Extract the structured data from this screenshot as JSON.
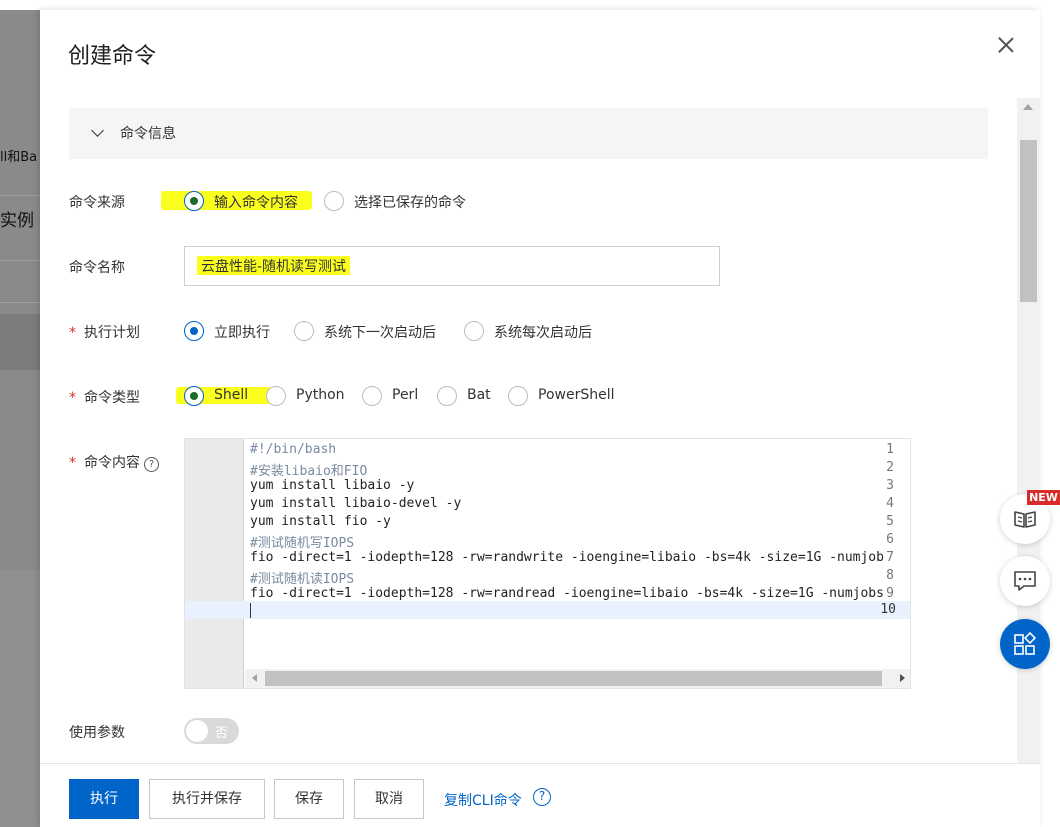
{
  "background": {
    "fragments": [
      "ll和Ba",
      "实例"
    ]
  },
  "drawer": {
    "title": "创建命令",
    "section_title": "命令信息",
    "fields": {
      "source": {
        "label": "命令来源",
        "options": [
          "输入命令内容",
          "选择已保存的命令"
        ],
        "selected": "输入命令内容"
      },
      "name": {
        "label": "命令名称",
        "value": "云盘性能-随机读写测试"
      },
      "schedule": {
        "required_mark": "*",
        "label": "执行计划",
        "options": [
          "立即执行",
          "系统下一次启动后",
          "系统每次启动后"
        ],
        "selected": "立即执行"
      },
      "type": {
        "required_mark": "*",
        "label": "命令类型",
        "options": [
          "Shell",
          "Python",
          "Perl",
          "Bat",
          "PowerShell"
        ],
        "selected": "Shell"
      },
      "content": {
        "required_mark": "*",
        "label": "命令内容",
        "help_icon": "?",
        "line_numbers": [
          "1",
          "2",
          "3",
          "4",
          "5",
          "6",
          "7",
          "8",
          "9",
          "10"
        ],
        "lines": [
          "#!/bin/bash",
          "#安装libaio和FIO",
          "yum install libaio -y",
          "yum install libaio-devel -y",
          "yum install fio -y",
          "#测试随机写IOPS",
          "fio -direct=1 -iodepth=128 -rw=randwrite -ioengine=libaio -bs=4k -size=1G -numjob",
          "#测试随机读IOPS",
          "fio -direct=1 -iodepth=128 -rw=randread -ioengine=libaio -bs=4k -size=1G -numjobs",
          ""
        ]
      },
      "params": {
        "label": "使用参数",
        "toggle_text": "否",
        "enabled": false
      }
    },
    "footer": {
      "run": "执行",
      "run_save": "执行并保存",
      "save": "保存",
      "cancel": "取消",
      "copy_cli": "复制CLI命令",
      "help_icon": "?"
    }
  },
  "side_widgets": {
    "badge": "NEW",
    "icons": [
      "book-icon",
      "chat-icon",
      "apps-icon"
    ]
  },
  "colors": {
    "primary": "#0064c8",
    "highlight": "#fbff1e",
    "required": "#d93026"
  }
}
